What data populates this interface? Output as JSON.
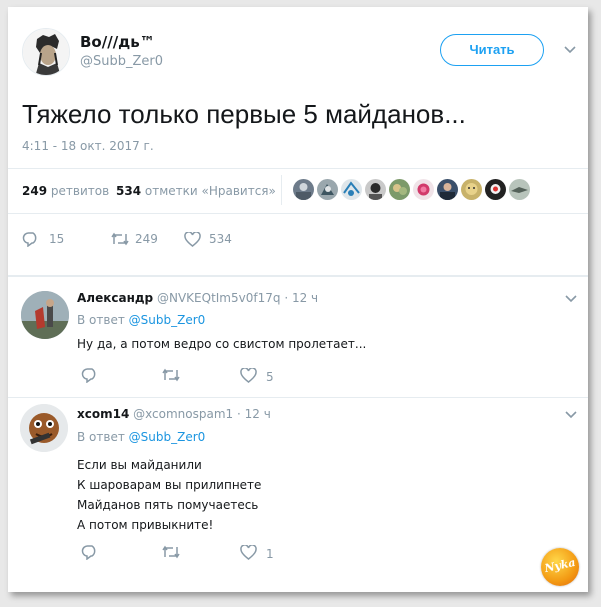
{
  "tweet": {
    "author_name": "Во///дь™",
    "author_handle": "@Subb_Zer0",
    "follow_label": "Читать",
    "text": "Тяжело только первые 5 майданов...",
    "timestamp": "4:11 - 18 окт. 2017 г.",
    "retweets_count": "249",
    "retweets_label": "ретвитов",
    "likes_count": "534",
    "likes_label": "отметки «Нравится»",
    "actions": {
      "replies": "15",
      "retweets": "249",
      "likes": "534"
    }
  },
  "replies": [
    {
      "name": "Александр",
      "handle": "@NVKEQtIm5v0f17q",
      "time": "· 12 ч",
      "reply_to_prefix": "В ответ",
      "reply_to_handle": "@Subb_Zer0",
      "text": "Ну да, а потом ведро со свистом пролетает...",
      "actions": {
        "replies": "",
        "retweets": "",
        "likes": "5"
      }
    },
    {
      "name": "xcom14",
      "handle": "@xcomnospam1",
      "time": "· 12 ч",
      "reply_to_prefix": "В ответ",
      "reply_to_handle": "@Subb_Zer0",
      "text_lines": [
        "Если вы майданили",
        "К шароварам вы прилипнете",
        "Майданов пять помучаетесь",
        "А потом привыкните!"
      ],
      "actions": {
        "replies": "",
        "retweets": "",
        "likes": "1"
      }
    }
  ],
  "watermark": "Nyka",
  "colors": {
    "accent": "#1da1f2",
    "link": "#1b95e0",
    "muted": "#8899a6",
    "text": "#14171a",
    "like_heart": "#e0245e",
    "divider": "#e6ecf0"
  }
}
